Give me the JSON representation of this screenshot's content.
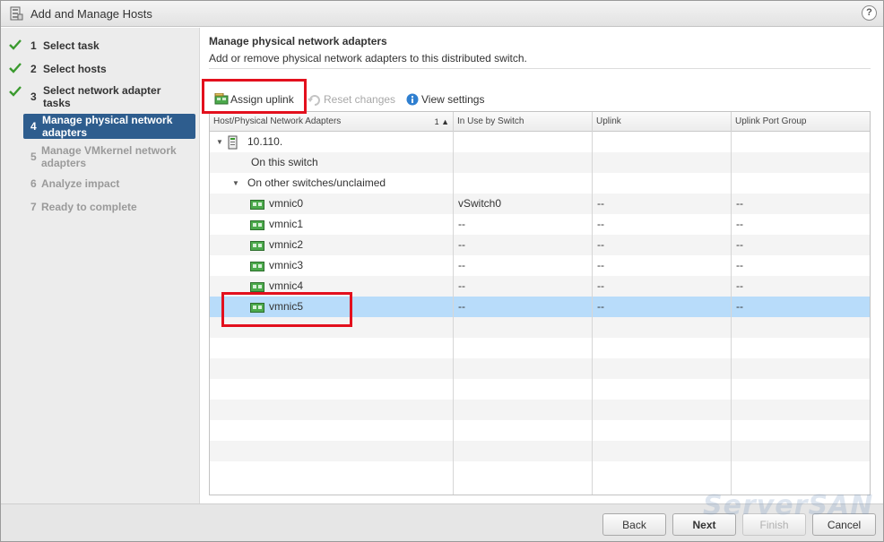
{
  "window": {
    "title": "Add and Manage Hosts",
    "help_label": "?"
  },
  "steps": [
    {
      "num": "1",
      "label": "Select task",
      "state": "done"
    },
    {
      "num": "2",
      "label": "Select hosts",
      "state": "done"
    },
    {
      "num": "3",
      "label": "Select network adapter tasks",
      "state": "done"
    },
    {
      "num": "4",
      "label": "Manage physical network adapters",
      "state": "active"
    },
    {
      "num": "5",
      "label": "Manage VMkernel network adapters",
      "state": "disabled"
    },
    {
      "num": "6",
      "label": "Analyze impact",
      "state": "disabled"
    },
    {
      "num": "7",
      "label": "Ready to complete",
      "state": "disabled"
    }
  ],
  "main": {
    "heading": "Manage physical network adapters",
    "subheading": "Add or remove physical network adapters to this distributed switch."
  },
  "toolbar": {
    "assign_uplink": "Assign uplink",
    "reset_changes": "Reset changes",
    "view_settings": "View settings"
  },
  "grid": {
    "columns": [
      "Host/Physical Network Adapters",
      "In Use by Switch",
      "Uplink",
      "Uplink Port Group"
    ],
    "sort_indicator": "1 ▲",
    "host": "10.110.",
    "groups": {
      "on_this_switch": "On this switch",
      "other": "On other switches/unclaimed"
    },
    "rows": [
      {
        "name": "vmnic0",
        "in_use": "vSwitch0",
        "uplink": "--",
        "port_group": "--"
      },
      {
        "name": "vmnic1",
        "in_use": "--",
        "uplink": "--",
        "port_group": "--"
      },
      {
        "name": "vmnic2",
        "in_use": "--",
        "uplink": "--",
        "port_group": "--"
      },
      {
        "name": "vmnic3",
        "in_use": "--",
        "uplink": "--",
        "port_group": "--"
      },
      {
        "name": "vmnic4",
        "in_use": "--",
        "uplink": "--",
        "port_group": "--"
      },
      {
        "name": "vmnic5",
        "in_use": "--",
        "uplink": "--",
        "port_group": "--",
        "selected": true
      }
    ]
  },
  "footer": {
    "back": "Back",
    "next": "Next",
    "finish": "Finish",
    "cancel": "Cancel"
  },
  "watermark": "ServerSAN",
  "colors": {
    "active_step": "#2e5d8e",
    "selected_row": "#b8dcfa",
    "highlight_box": "#e3101d",
    "check": "#3a9a2e"
  }
}
